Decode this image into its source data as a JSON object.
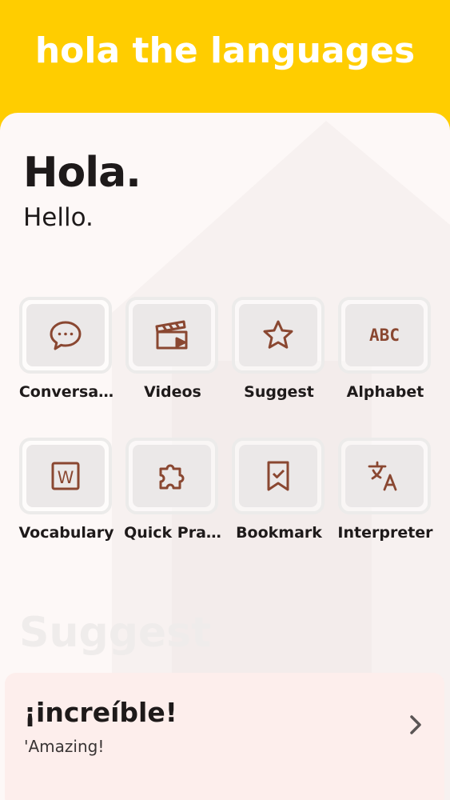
{
  "app": {
    "title": "hola the languages"
  },
  "greeting": {
    "phrase": "Hola.",
    "translation": "Hello."
  },
  "menu": {
    "items": [
      {
        "label": "Conversa…",
        "icon": "chat-bubble-icon"
      },
      {
        "label": "Videos",
        "icon": "clapperboard-icon"
      },
      {
        "label": "Suggest",
        "icon": "star-icon"
      },
      {
        "label": "Alphabet",
        "icon": "abc-icon",
        "icon_text": "ABC"
      },
      {
        "label": "Vocabulary",
        "icon": "word-document-icon",
        "icon_text": "W"
      },
      {
        "label": "Quick Pra…",
        "icon": "puzzle-icon"
      },
      {
        "label": "Bookmark",
        "icon": "bookmark-check-icon"
      },
      {
        "label": "Interpreter",
        "icon": "translate-icon"
      }
    ]
  },
  "suggest": {
    "section_title": "Suggest",
    "word": "¡increíble!",
    "meaning": "'Amazing!"
  },
  "colors": {
    "header": "#ffcd00",
    "icon": "#8a4731",
    "sheet": "#fdf8f7",
    "card": "#fdeeec",
    "text": "#1e1a1a"
  }
}
